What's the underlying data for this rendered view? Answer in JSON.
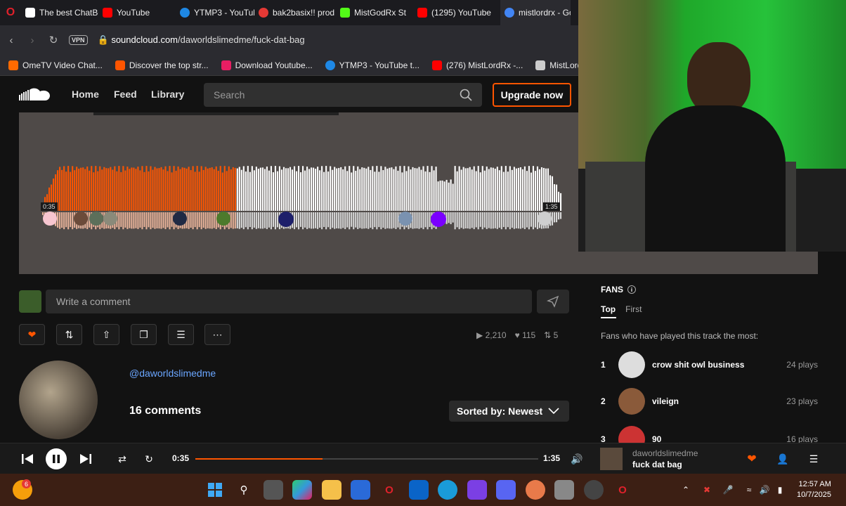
{
  "browser": {
    "tabs": [
      {
        "label": "The best ChatBot",
        "color": "#ffffff"
      },
      {
        "label": "YouTube",
        "color": "#ff0000"
      },
      {
        "label": "YTMP3 - YouTub",
        "color": "#1e88e5"
      },
      {
        "label": "bak2basix!! prod",
        "color": "#e53935"
      },
      {
        "label": "MistGodRx St",
        "color": "#53fc18"
      },
      {
        "label": "(1295) YouTube",
        "color": "#ff0000"
      },
      {
        "label": "mistlordrx - Go",
        "color": "#4285f4"
      }
    ],
    "url_host": "soundcloud.com",
    "url_path": "/daworldslimedme/fuck-dat-bag",
    "vpn_label": "VPN",
    "bookmarks": [
      {
        "label": "OmeTV Video Chat...",
        "color": "#ff6a00"
      },
      {
        "label": "Discover the top str...",
        "color": "#ff5500"
      },
      {
        "label": "Download Youtube...",
        "color": "#e91e63"
      },
      {
        "label": "YTMP3 - YouTube t...",
        "color": "#1e88e5"
      },
      {
        "label": "(276) MistLordRx -...",
        "color": "#ff0000"
      },
      {
        "label": "MistLordRx ide...",
        "color": "#cccccc"
      }
    ]
  },
  "header": {
    "nav": [
      "Home",
      "Feed",
      "Library"
    ],
    "search_placeholder": "Search",
    "upgrade_label": "Upgrade now"
  },
  "waveform": {
    "elapsed": "0:35",
    "duration": "1:35",
    "played_fraction": 0.37,
    "played_color": "#ff5500"
  },
  "comment": {
    "placeholder": "Write a comment"
  },
  "stats": {
    "plays": "2,210",
    "likes": "115",
    "reposts": "5"
  },
  "artist": {
    "handle": "@daworldslimedme",
    "comments_label": "16 comments",
    "sort_label": "Sorted by: Newest"
  },
  "fans": {
    "title": "FANS",
    "tabs": [
      "Top",
      "First"
    ],
    "subtitle": "Fans who have played this track the most:",
    "rows": [
      {
        "rank": "1",
        "name": "crow shit owl business",
        "plays": "24 plays"
      },
      {
        "rank": "2",
        "name": "vileign",
        "plays": "23 plays"
      },
      {
        "rank": "3",
        "name": "90",
        "plays": "16 plays"
      }
    ]
  },
  "player": {
    "elapsed": "0:35",
    "duration": "1:35",
    "progress": 0.37,
    "now_artist": "daworldslimedme",
    "now_title": "fuck dat bag"
  },
  "taskbar": {
    "time": "12:57 AM",
    "date": "10/7/2025",
    "badge": "6"
  }
}
